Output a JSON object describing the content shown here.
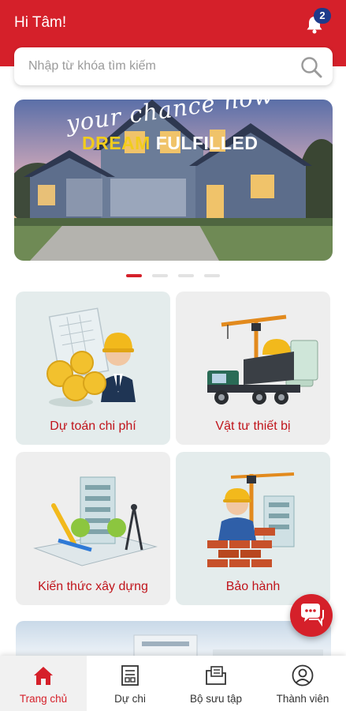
{
  "header": {
    "greeting": "Hi Tâm!",
    "notification_count": "2"
  },
  "search": {
    "placeholder": "Nhập từ khóa tìm kiếm"
  },
  "banner": {
    "line1": "your chance now",
    "line2a": "DREAM",
    "line2b": "FULFILLED",
    "slide_count": 4,
    "active_slide": 1
  },
  "cards": [
    {
      "label": "Dự toán chi phí"
    },
    {
      "label": "Vật tư thiết bị"
    },
    {
      "label": "Kiến thức xây dựng"
    },
    {
      "label": "Bảo hành"
    }
  ],
  "nav": [
    {
      "label": "Trang chủ",
      "icon": "home-icon",
      "active": true
    },
    {
      "label": "Dự chi",
      "icon": "document-icon",
      "active": false
    },
    {
      "label": "Bộ sưu tập",
      "icon": "folder-icon",
      "active": false
    },
    {
      "label": "Thành viên",
      "icon": "user-icon",
      "active": false
    }
  ],
  "colors": {
    "primary": "#d5202a",
    "badge": "#1e3a8a",
    "card_bg": "#e4ecec"
  }
}
